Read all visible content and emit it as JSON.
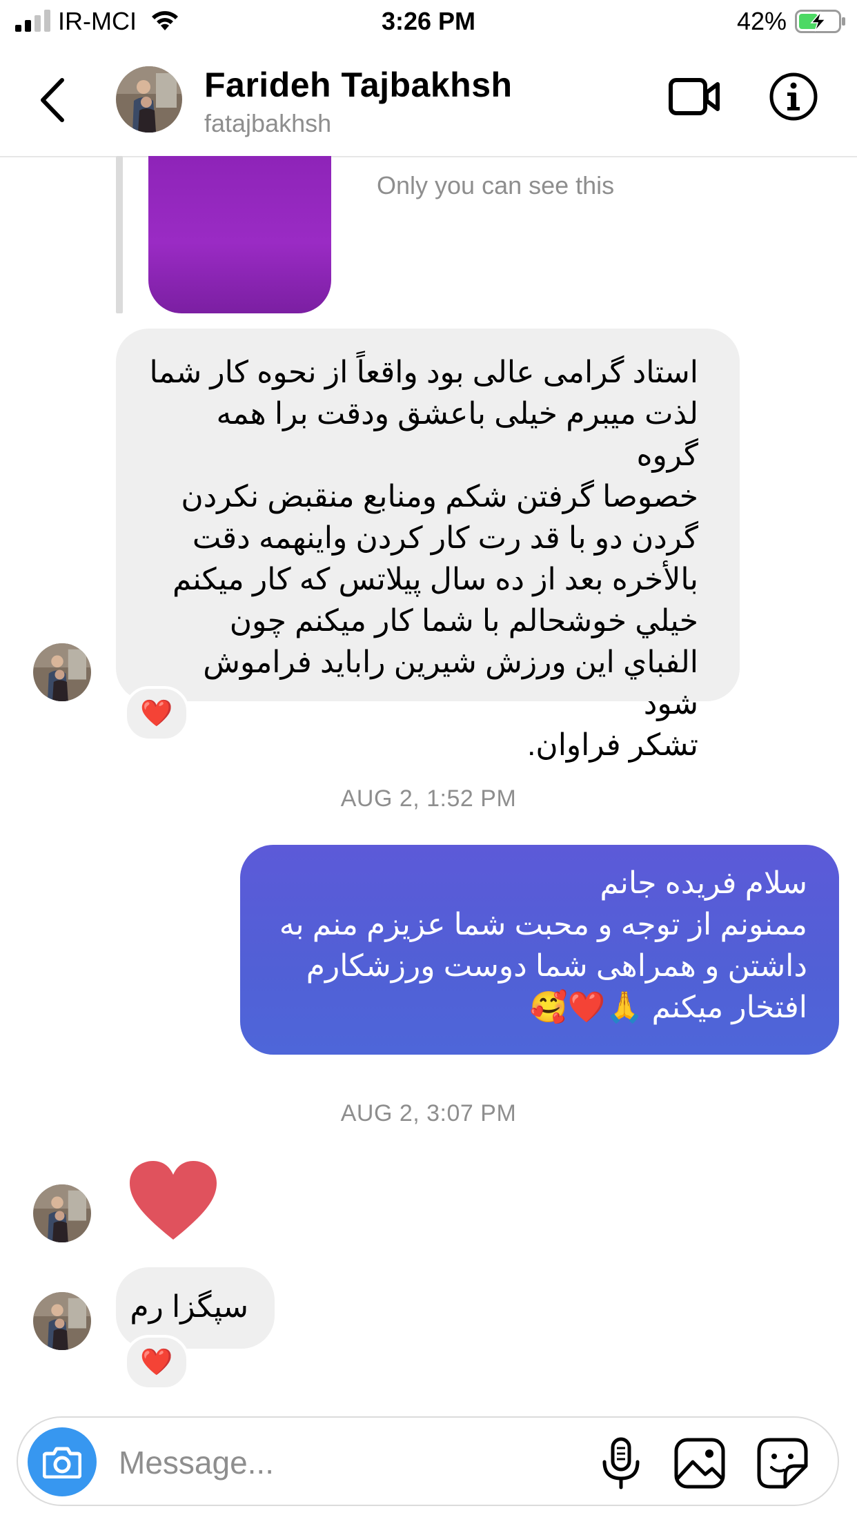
{
  "status_bar": {
    "carrier": "IR-MCI",
    "time": "3:26 PM",
    "battery": "42%"
  },
  "header": {
    "name": "Farideh Tajbakhsh",
    "username": "fatajbakhsh"
  },
  "story_reply": {
    "note": "Only you can see this"
  },
  "messages": [
    {
      "direction": "incoming",
      "text": "استاد گرامی عالی بود واقعاً از نحوه کار شما\nلذت میبرم خیلی باعشق ودقت برا همه گروه\nخصوصا گرفتن شکم ومنابع منقبض نکردن\nگردن دو با قد رت کار کردن واینهمه دقت\nبالأخره بعد از ده سال پیلاتس که کار میکنم\nخيلي خوشحالم  با شما کار میکنم چون\nالفباي اين ورزش شيرين رابايد فراموش شود\nتشکر فراوان.",
      "reaction": "❤️"
    },
    {
      "direction": "outgoing",
      "timestamp": "AUG 2, 1:52 PM",
      "text": "سلام فریده جانم\nممنونم از توجه و محبت شما عزیزم منم به\nداشتن و همراهی شما دوست ورزشکارم\nافتخار میکنم 🙏❤️🥰"
    },
    {
      "direction": "incoming",
      "timestamp": "AUG 2, 3:07 PM",
      "text": "❤️"
    },
    {
      "direction": "incoming",
      "text": "سپگزا رم",
      "reaction": "❤️"
    }
  ],
  "composer": {
    "placeholder": "Message..."
  },
  "colors": {
    "outgoing_bubble": "#5160d6",
    "incoming_bubble": "#efefef",
    "camera_button": "#3797f0",
    "story_thumb": "#8e24b8",
    "big_heart": "#e0525d"
  }
}
